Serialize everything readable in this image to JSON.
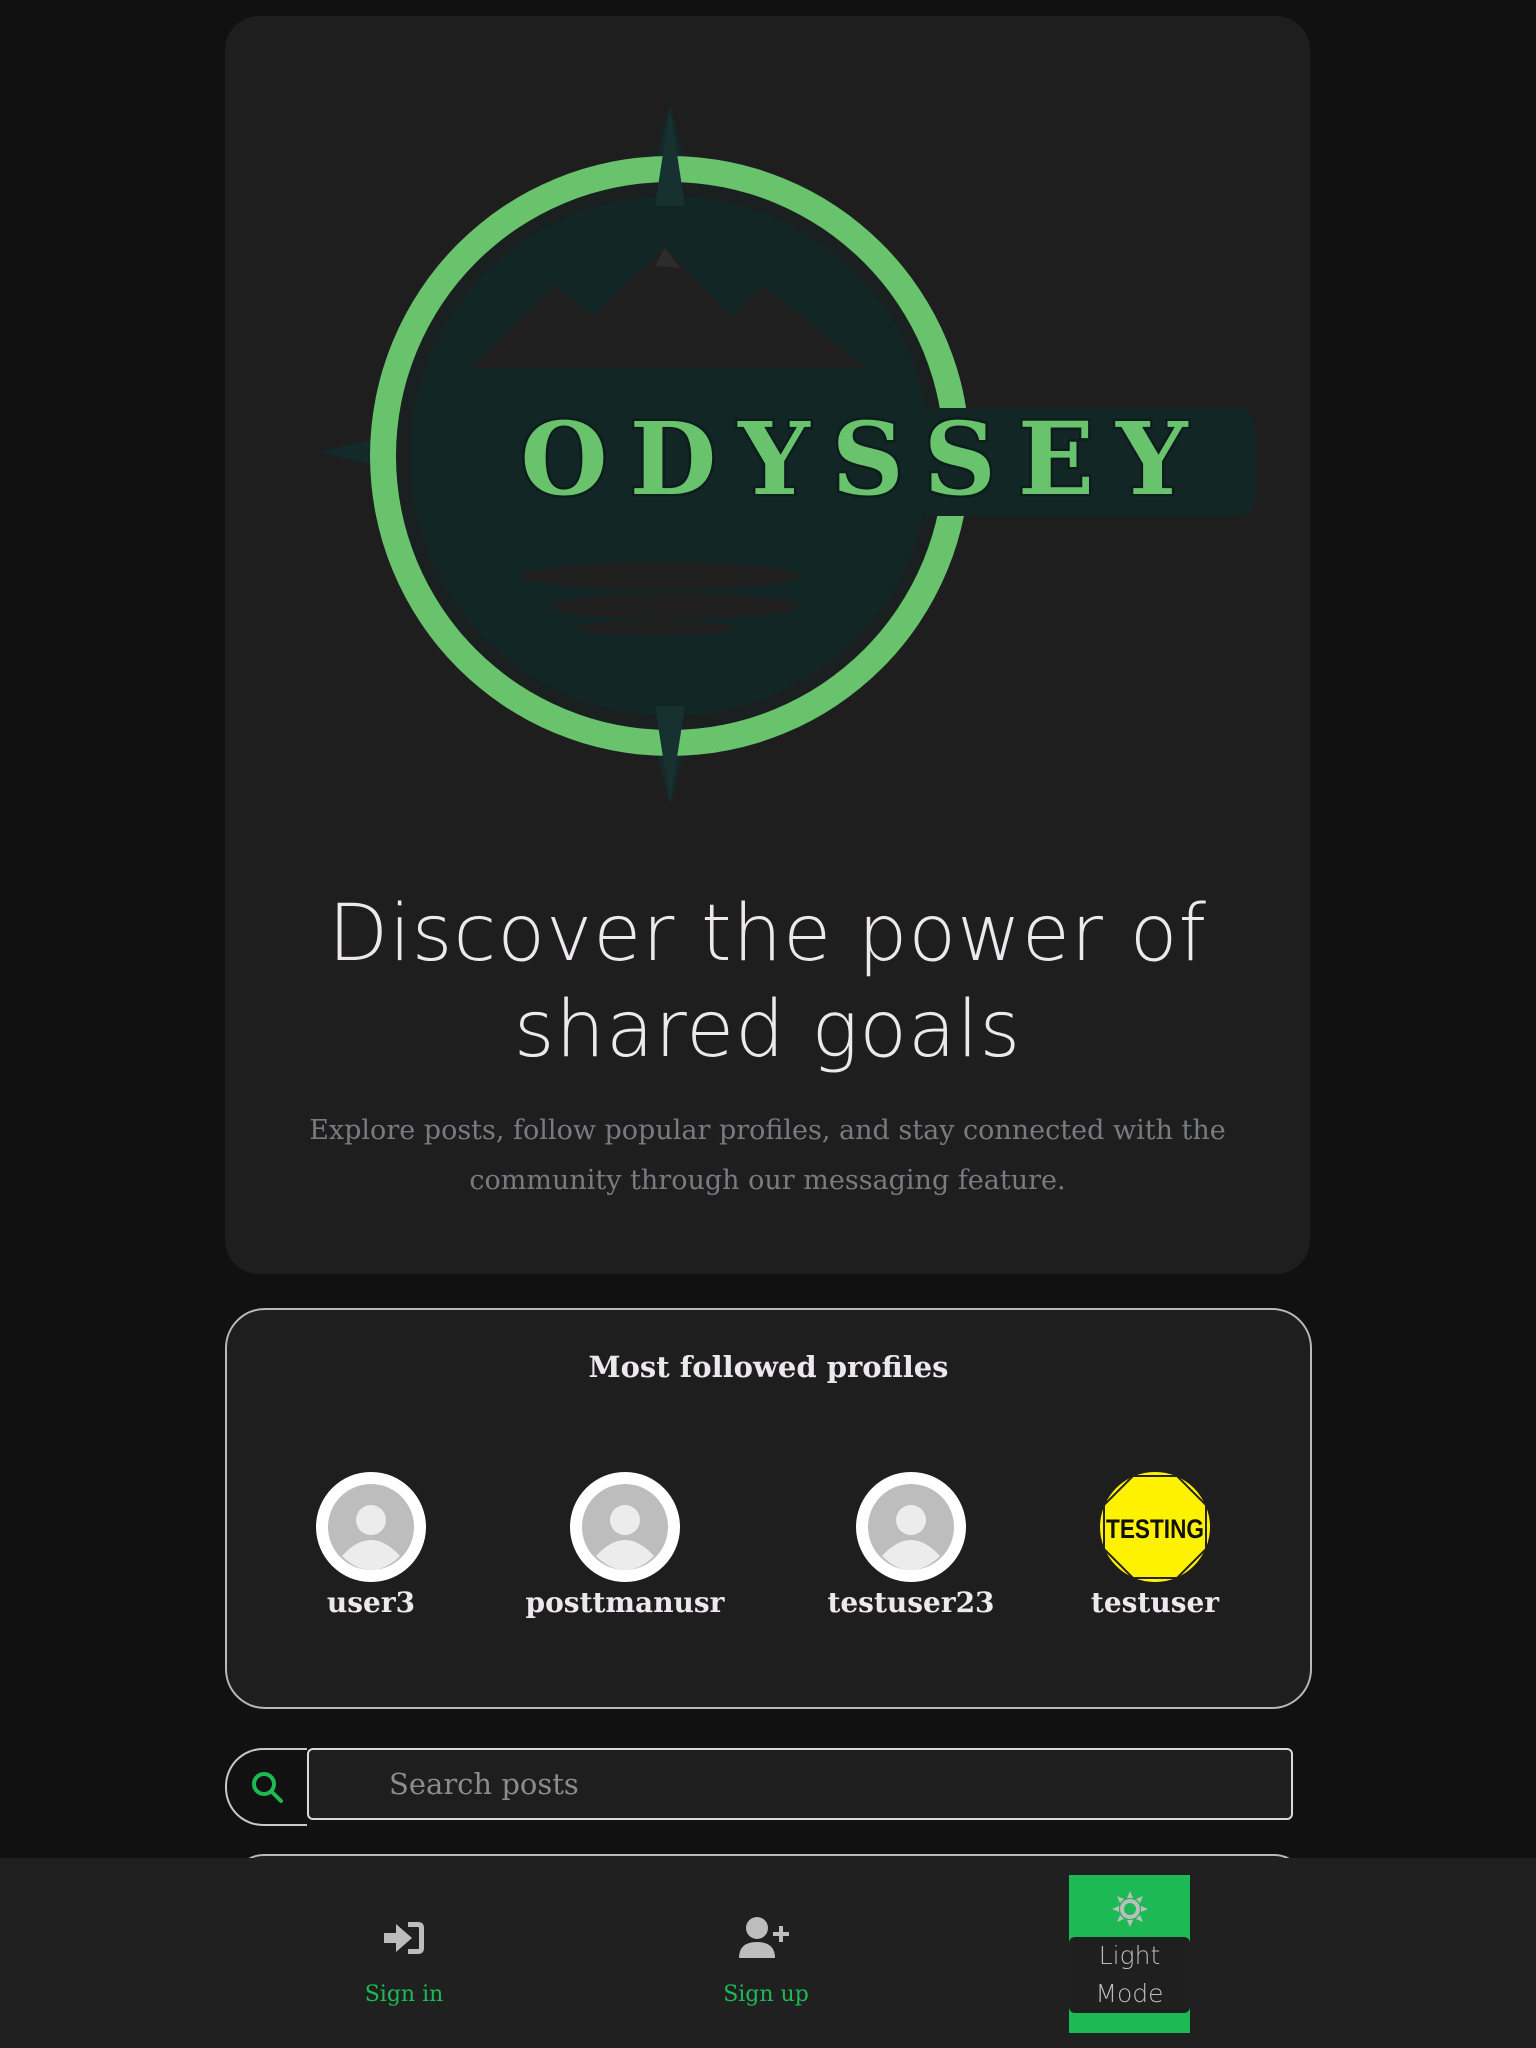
{
  "hero": {
    "logo_text": "ODYSSEY",
    "headline_line1": "Discover the power of",
    "headline_line2": "shared goals",
    "subtitle": "Explore posts, follow popular profiles, and stay connected with the community through our messaging feature."
  },
  "profiles": {
    "title": "Most followed profiles",
    "items": [
      {
        "name": "user3",
        "avatar": "default-avatar-icon"
      },
      {
        "name": "posttmanusr",
        "avatar": "default-avatar-icon"
      },
      {
        "name": "testuser23",
        "avatar": "default-avatar-icon"
      },
      {
        "name": "testuser",
        "avatar": "testing-sign-image",
        "avatar_text": "TESTING"
      }
    ]
  },
  "search": {
    "placeholder": "Search posts",
    "value": ""
  },
  "nav": {
    "signin_label": "Sign in",
    "signup_label": "Sign up",
    "mode_line1": "Light",
    "mode_line2": "Mode"
  },
  "colors": {
    "accent": "#1db954",
    "logo_green": "#69c36d",
    "logo_dark": "#112626",
    "background": "#111111",
    "card": "#1e1e1e"
  }
}
